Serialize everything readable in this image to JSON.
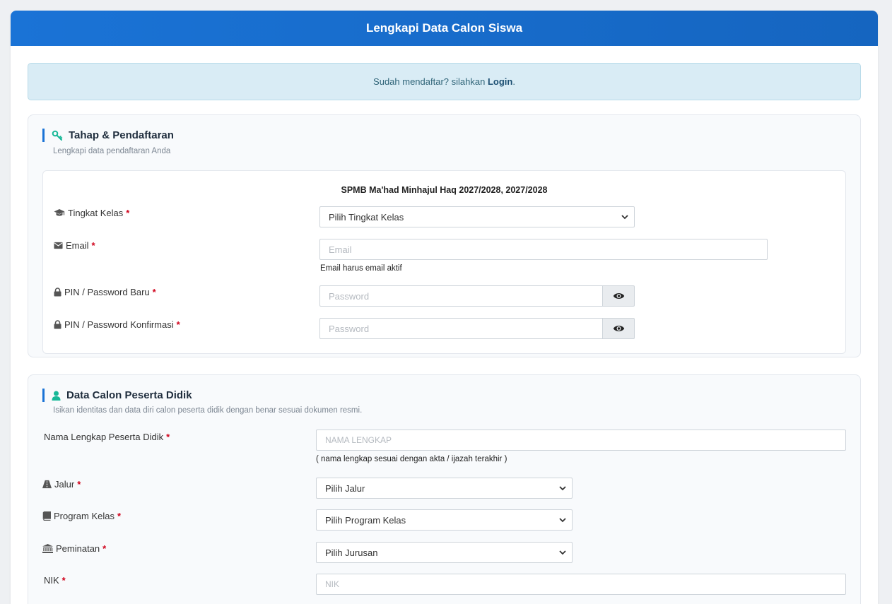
{
  "header": {
    "title": "Lengkapi Data Calon Siswa"
  },
  "alert": {
    "text": "Sudah mendaftar? silahkan ",
    "link": "Login",
    "suffix": "."
  },
  "section1": {
    "title": "Tahap & Pendaftaran",
    "subtitle": "Lengkapi data pendaftaran Anda",
    "inner_title": "SPMB Ma'had Minhajul Haq 2027/2028, 2027/2028",
    "tingkat": {
      "label": "Tingkat Kelas",
      "required": "*",
      "selected": "Pilih Tingkat Kelas",
      "icon": "graduation-cap-icon"
    },
    "email": {
      "label": "Email",
      "required": "*",
      "placeholder": "Email",
      "help": "Email harus email aktif",
      "icon": "envelope-icon"
    },
    "pin": {
      "label": "PIN / Password Baru",
      "required": "*",
      "placeholder": "Password",
      "icon": "lock-icon"
    },
    "pin_confirm": {
      "label": "PIN / Password Konfirmasi",
      "required": "*",
      "placeholder": "Password",
      "icon": "lock-icon"
    }
  },
  "section2": {
    "title": "Data Calon Peserta Didik",
    "subtitle": "Isikan identitas dan data diri calon peserta didik dengan benar sesuai dokumen resmi.",
    "nama": {
      "label": "Nama Lengkap Peserta Didik",
      "required": "*",
      "placeholder": "NAMA LENGKAP",
      "help": "( nama lengkap sesuai dengan akta / ijazah terakhir )"
    },
    "jalur": {
      "label": "Jalur",
      "required": "*",
      "selected": "Pilih Jalur",
      "icon": "road-icon"
    },
    "program": {
      "label": "Program Kelas",
      "required": "*",
      "selected": "Pilih Program Kelas",
      "icon": "book-icon"
    },
    "peminatan": {
      "label": "Peminatan",
      "required": "*",
      "selected": "Pilih Jurusan",
      "icon": "institution-icon"
    },
    "nik": {
      "label": "NIK",
      "required": "*",
      "placeholder": "NIK"
    }
  },
  "colors": {
    "primary": "#1a73d6",
    "accent": "#17b897",
    "required": "#d0021b"
  }
}
